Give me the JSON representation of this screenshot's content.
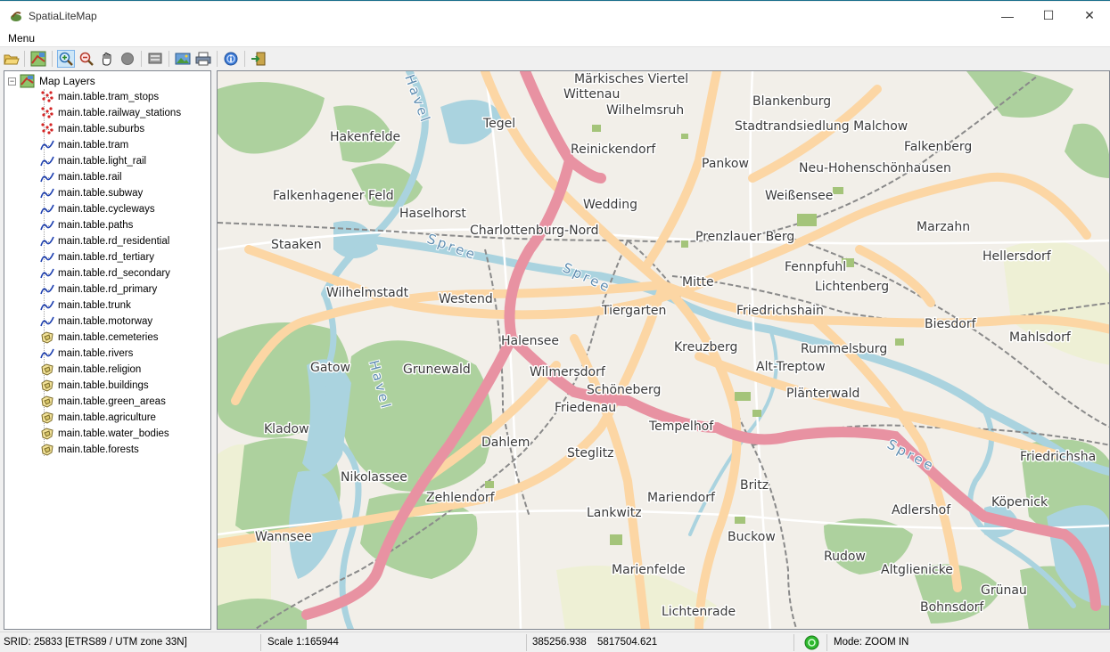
{
  "window": {
    "title": "SpatiaLiteMap",
    "minimize": "—",
    "maximize": "☐",
    "close": "✕"
  },
  "menu": {
    "label": "Menu"
  },
  "toolbar": {
    "buttons": [
      "open-icon",
      "map-properties-icon",
      "zoom-in-icon",
      "zoom-out-icon",
      "pan-icon",
      "stop-icon",
      "layer-config-icon",
      "export-image-icon",
      "print-icon",
      "about-icon",
      "exit-icon"
    ],
    "active": "zoom-in-icon"
  },
  "tree": {
    "root": "Map Layers",
    "layers": [
      {
        "name": "main.table.tram_stops",
        "kind": "point"
      },
      {
        "name": "main.table.railway_stations",
        "kind": "point"
      },
      {
        "name": "main.table.suburbs",
        "kind": "point"
      },
      {
        "name": "main.table.tram",
        "kind": "line"
      },
      {
        "name": "main.table.light_rail",
        "kind": "line"
      },
      {
        "name": "main.table.rail",
        "kind": "line"
      },
      {
        "name": "main.table.subway",
        "kind": "line"
      },
      {
        "name": "main.table.cycleways",
        "kind": "line"
      },
      {
        "name": "main.table.paths",
        "kind": "line"
      },
      {
        "name": "main.table.rd_residential",
        "kind": "line"
      },
      {
        "name": "main.table.rd_tertiary",
        "kind": "line"
      },
      {
        "name": "main.table.rd_secondary",
        "kind": "line"
      },
      {
        "name": "main.table.rd_primary",
        "kind": "line"
      },
      {
        "name": "main.table.trunk",
        "kind": "line"
      },
      {
        "name": "main.table.motorway",
        "kind": "line"
      },
      {
        "name": "main.table.cemeteries",
        "kind": "polygon"
      },
      {
        "name": "main.table.rivers",
        "kind": "line"
      },
      {
        "name": "main.table.religion",
        "kind": "polygon"
      },
      {
        "name": "main.table.buildings",
        "kind": "polygon"
      },
      {
        "name": "main.table.green_areas",
        "kind": "polygon"
      },
      {
        "name": "main.table.agriculture",
        "kind": "polygon"
      },
      {
        "name": "main.table.water_bodies",
        "kind": "polygon"
      },
      {
        "name": "main.table.forests",
        "kind": "polygon"
      }
    ]
  },
  "map": {
    "places": [
      "Märkisches Viertel",
      "Wittenau",
      "Wilhelmsruh",
      "Blankenburg",
      "Tegel",
      "Stadtrandsiedlung Malchow",
      "Hakenfelde",
      "Reinickendorf",
      "Falkenberg",
      "Pankow",
      "Neu-Hohenschönhausen",
      "Falkenhagener Feld",
      "Weißensee",
      "Wedding",
      "Haselhorst",
      "Marzahn",
      "Charlottenburg-Nord",
      "Prenzlauer Berg",
      "Staaken",
      "Hellersdorf",
      "Fennpfuhl",
      "Wilhelmstadt",
      "Mitte",
      "Lichtenberg",
      "Westend",
      "Tiergarten",
      "Friedrichshain",
      "Biesdorf",
      "Halensee",
      "Kreuzberg",
      "Rummelsburg",
      "Mahlsdorf",
      "Gatow",
      "Grunewald",
      "Wilmersdorf",
      "Alt-Treptow",
      "Schöneberg",
      "Plänterwald",
      "Friedenau",
      "Kladow",
      "Tempelhof",
      "Dahlem",
      "Steglitz",
      "Friedrichsha",
      "Nikolassee",
      "Britz",
      "Zehlendorf",
      "Mariendorf",
      "Adlershof",
      "Köpenick",
      "Lankwitz",
      "Wannsee",
      "Buckow",
      "Rudow",
      "Marienfelde",
      "Altglienicke",
      "Grünau",
      "Lichtenrade",
      "Bohnsdorf"
    ],
    "rivers": [
      "Spree",
      "Spree",
      "Spree",
      "Havel",
      "Havel"
    ],
    "colors": {
      "land": "#f2efe9",
      "forest": "#a9cf99",
      "water": "#aad3df",
      "motorway": "#e892a2",
      "trunk": "#f9b29c",
      "primary": "#fcd6a4",
      "rail": "#8a8a8a",
      "agriculture": "#eef0d5"
    }
  },
  "status": {
    "srid": "SRID: 25833 [ETRS89 / UTM zone 33N]",
    "scale": "Scale 1:165944",
    "x": "385256.938",
    "y": "5817504.621",
    "mode": "Mode: ZOOM IN"
  }
}
